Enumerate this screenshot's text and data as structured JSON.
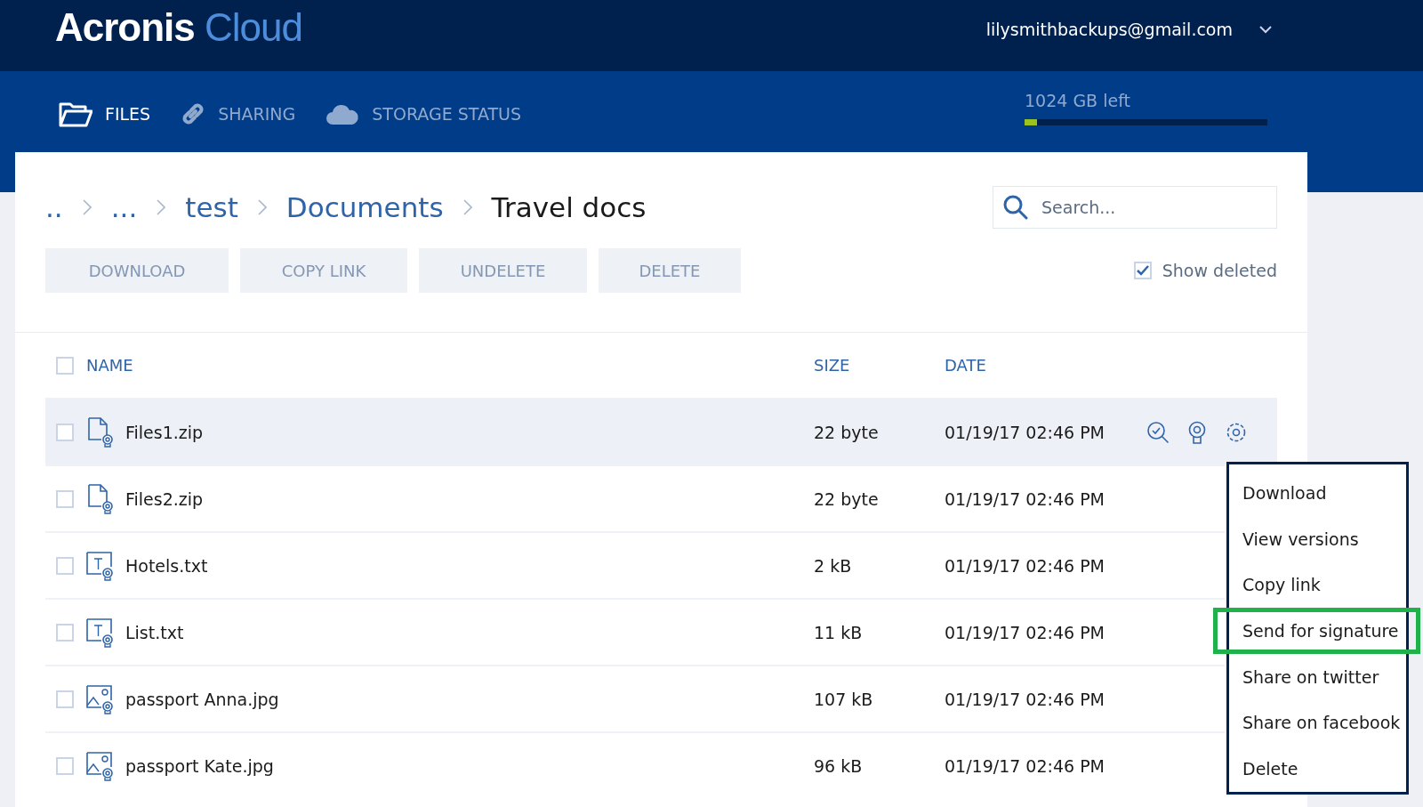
{
  "header": {
    "logo": {
      "brand": "Acronis",
      "product": "Cloud"
    },
    "account": "lilysmithbackups@gmail.com"
  },
  "nav": {
    "tabs": [
      {
        "label": "FILES",
        "selected": true
      },
      {
        "label": "SHARING",
        "selected": false
      },
      {
        "label": "STORAGE STATUS",
        "selected": false
      }
    ],
    "storage": {
      "label": "1024 GB left",
      "level": 0.05
    }
  },
  "breadcrumb": [
    {
      "label": "..",
      "current": false
    },
    {
      "label": "...",
      "current": false
    },
    {
      "label": "test",
      "current": false
    },
    {
      "label": "Documents",
      "current": false
    },
    {
      "label": "Travel docs",
      "current": true
    }
  ],
  "search": {
    "placeholder": "Search..."
  },
  "toolbar": [
    {
      "label": "DOWNLOAD",
      "disabled": true
    },
    {
      "label": "COPY LINK",
      "disabled": true
    },
    {
      "label": "UNDELETE",
      "disabled": true
    },
    {
      "label": "DELETE",
      "disabled": true
    }
  ],
  "show_deleted": {
    "label": "Show deleted",
    "checked": true
  },
  "table": {
    "select_all_checked": false,
    "columns": [
      "NAME",
      "SIZE",
      "DATE"
    ],
    "rows": [
      {
        "name": "Files1.zip",
        "kind": "archive",
        "size": "22 byte",
        "date": "01/19/17 02:46 PM",
        "selected": true,
        "checked": false
      },
      {
        "name": "Files2.zip",
        "kind": "archive",
        "size": "22 byte",
        "date": "01/19/17 02:46 PM",
        "selected": false,
        "checked": false
      },
      {
        "name": "Hotels.txt",
        "kind": "text",
        "size": "2 kB",
        "date": "01/19/17 02:46 PM",
        "selected": false,
        "checked": false
      },
      {
        "name": "List.txt",
        "kind": "text",
        "size": "11 kB",
        "date": "01/19/17 02:46 PM",
        "selected": false,
        "checked": false
      },
      {
        "name": "passport Anna.jpg",
        "kind": "image",
        "size": "107 kB",
        "date": "01/19/17 02:46 PM",
        "selected": false,
        "checked": false
      },
      {
        "name": "passport Kate.jpg",
        "kind": "image",
        "size": "96 kB",
        "date": "01/19/17 02:46 PM",
        "selected": false,
        "checked": false
      }
    ]
  },
  "context_menu": [
    {
      "label": "Download",
      "highlighted": false
    },
    {
      "label": "View versions",
      "highlighted": false
    },
    {
      "label": "Copy link",
      "highlighted": false
    },
    {
      "label": "Send for signature",
      "highlighted": true
    },
    {
      "label": "Share on twitter",
      "highlighted": false
    },
    {
      "label": "Share on facebook",
      "highlighted": false
    },
    {
      "label": "Delete",
      "highlighted": false
    }
  ]
}
